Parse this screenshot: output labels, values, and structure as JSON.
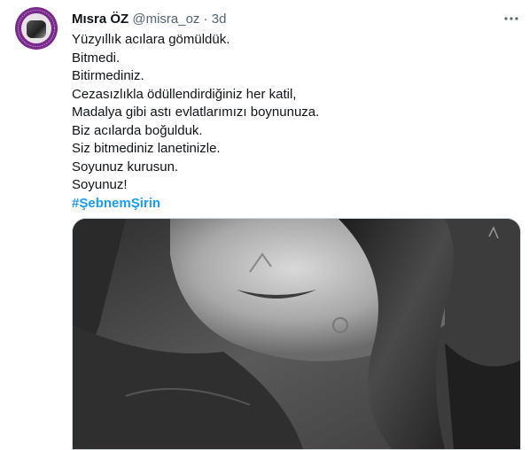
{
  "tweet": {
    "author_name": "Mısra ÖZ",
    "author_handle": "@misra_oz",
    "separator": "·",
    "time": "3d",
    "lines": [
      "Yüzyıllık acılara gömüldük.",
      "Bitmedi.",
      "Bitirmediniz.",
      "Cezasızlıkla ödüllendirdiğiniz her katil,",
      "Madalya gibi astı evlatlarımızı boynunuza.",
      "Biz acılarda boğulduk.",
      "Siz bitmediniz lanetinizle.",
      "Soyunuz kurusun.",
      "Soyunuz!"
    ],
    "hashtag": "#ŞebnemŞirin"
  },
  "icons": {
    "more": "more-horizontal-icon",
    "avatar": "profile-avatar"
  },
  "colors": {
    "text": "#0f1419",
    "secondary": "#536471",
    "link": "#1d9bf0",
    "avatar_ring": "#7a2a8c"
  }
}
